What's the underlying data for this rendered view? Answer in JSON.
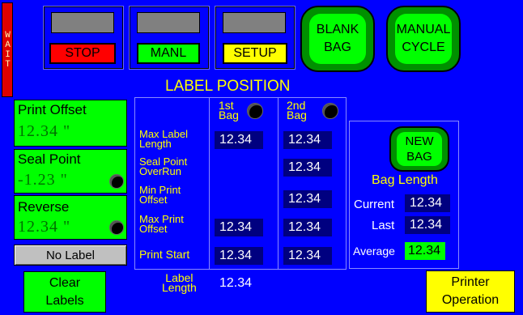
{
  "status": {
    "wait_label": "WAIT"
  },
  "toolbar": {
    "stop_label": "STOP",
    "manl_label": "MANL",
    "setup_label": "SETUP",
    "blank_bag_line1": "BLANK",
    "blank_bag_line2": "BAG",
    "manual_cycle_line1": "MANUAL",
    "manual_cycle_line2": "CYCLE"
  },
  "page_title": "LABEL POSITION",
  "left_panel": {
    "print_offset": {
      "label": "Print Offset",
      "value": "12.34 \""
    },
    "seal_point": {
      "label": "Seal Point",
      "value": "-1.23 \""
    },
    "reverse": {
      "label": "Reverse",
      "value": "12.34 \""
    },
    "no_label_button": "No Label"
  },
  "table": {
    "col1_header_line1": "1st",
    "col1_header_line2": "Bag",
    "col2_header_line1": "2nd",
    "col2_header_line2": "Bag",
    "rows": [
      {
        "label_line1": "Max Label",
        "label_line2": "Length",
        "bag1": "12.34",
        "bag2": "12.34"
      },
      {
        "label_line1": "Seal Point",
        "label_line2": "OverRun",
        "bag1": "",
        "bag2": "12.34"
      },
      {
        "label_line1": "Min Print",
        "label_line2": "Offset",
        "bag1": "",
        "bag2": "12.34"
      },
      {
        "label_line1": "Max Print",
        "label_line2": "Offset",
        "bag1": "12.34",
        "bag2": "12.34"
      },
      {
        "label_line1": "Print Start",
        "label_line2": "",
        "bag1": "12.34",
        "bag2": "12.34"
      }
    ],
    "label_length_line1": "Label",
    "label_length_line2": "Length",
    "label_length_value": "12.34"
  },
  "bag_length": {
    "new_bag_line1": "NEW",
    "new_bag_line2": "BAG",
    "title": "Bag Length",
    "current_label": "Current",
    "current_value": "12.34",
    "last_label": "Last",
    "last_value": "12.34",
    "average_label": "Average",
    "average_value": "12.34"
  },
  "footer": {
    "clear_labels_line1": "Clear",
    "clear_labels_line2": "Labels",
    "printer_operation_line1": "Printer",
    "printer_operation_line2": "Operation"
  },
  "colors": {
    "background": "#0000ff",
    "button_green": "#00ff00",
    "accent_yellow": "#ffff00",
    "stop_red": "#ff0000",
    "value_navy": "#000080"
  }
}
